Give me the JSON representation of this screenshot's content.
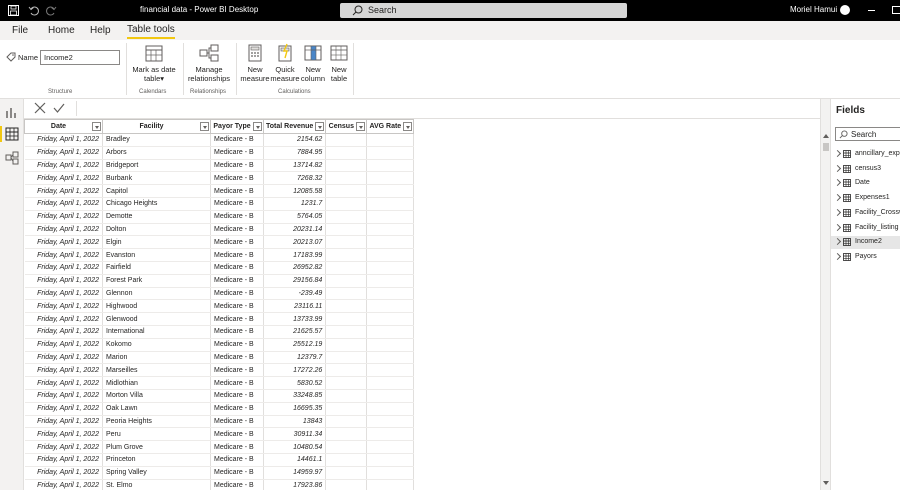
{
  "titlebar": {
    "title": "financial data - Power BI Desktop",
    "search_placeholder": "Search",
    "user": "Moriel Hamui"
  },
  "menu": {
    "tabs": [
      "File",
      "Home",
      "Help",
      "Table tools"
    ],
    "active": "Table tools"
  },
  "ribbon": {
    "name_label": "Name",
    "name_value": "Income2",
    "groups": {
      "structure": "Structure",
      "calendars": "Calendars",
      "relationships": "Relationships",
      "calculations": "Calculations"
    },
    "buttons": {
      "mark_date_line1": "Mark as date",
      "mark_date_line2": "table",
      "manage_rel_line1": "Manage",
      "manage_rel_line2": "relationships",
      "new_measure_line1": "New",
      "new_measure_line2": "measure",
      "quick_measure_line1": "Quick",
      "quick_measure_line2": "measure",
      "new_column_line1": "New",
      "new_column_line2": "column",
      "new_table_line1": "New",
      "new_table_line2": "table"
    }
  },
  "table": {
    "columns": [
      "Date",
      "Facility",
      "Payor Type",
      "Total Revenue",
      "Census",
      "AVG Rate"
    ],
    "rows": [
      [
        "Friday, April 1, 2022",
        "Bradley",
        "Medicare - B",
        "2154.62"
      ],
      [
        "Friday, April 1, 2022",
        "Arbors",
        "Medicare - B",
        "7884.95"
      ],
      [
        "Friday, April 1, 2022",
        "Bridgeport",
        "Medicare - B",
        "13714.82"
      ],
      [
        "Friday, April 1, 2022",
        "Burbank",
        "Medicare - B",
        "7268.32"
      ],
      [
        "Friday, April 1, 2022",
        "Capitol",
        "Medicare - B",
        "12085.58"
      ],
      [
        "Friday, April 1, 2022",
        "Chicago Heights",
        "Medicare - B",
        "1231.7"
      ],
      [
        "Friday, April 1, 2022",
        "Demotte",
        "Medicare - B",
        "5764.05"
      ],
      [
        "Friday, April 1, 2022",
        "Dolton",
        "Medicare - B",
        "20231.14"
      ],
      [
        "Friday, April 1, 2022",
        "Elgin",
        "Medicare - B",
        "20213.07"
      ],
      [
        "Friday, April 1, 2022",
        "Evanston",
        "Medicare - B",
        "17183.99"
      ],
      [
        "Friday, April 1, 2022",
        "Fairfield",
        "Medicare - B",
        "26952.82"
      ],
      [
        "Friday, April 1, 2022",
        "Forest Park",
        "Medicare - B",
        "29156.84"
      ],
      [
        "Friday, April 1, 2022",
        "Glennon",
        "Medicare - B",
        "-239.49"
      ],
      [
        "Friday, April 1, 2022",
        "Highwood",
        "Medicare - B",
        "23116.11"
      ],
      [
        "Friday, April 1, 2022",
        "Glenwood",
        "Medicare - B",
        "13733.99"
      ],
      [
        "Friday, April 1, 2022",
        "International",
        "Medicare - B",
        "21625.57"
      ],
      [
        "Friday, April 1, 2022",
        "Kokomo",
        "Medicare - B",
        "25512.19"
      ],
      [
        "Friday, April 1, 2022",
        "Marion",
        "Medicare - B",
        "12379.7"
      ],
      [
        "Friday, April 1, 2022",
        "Marseilles",
        "Medicare - B",
        "17272.26"
      ],
      [
        "Friday, April 1, 2022",
        "Midlothian",
        "Medicare - B",
        "5830.52"
      ],
      [
        "Friday, April 1, 2022",
        "Morton Villa",
        "Medicare - B",
        "33248.85"
      ],
      [
        "Friday, April 1, 2022",
        "Oak Lawn",
        "Medicare - B",
        "16695.35"
      ],
      [
        "Friday, April 1, 2022",
        "Peoria Heights",
        "Medicare - B",
        "13843"
      ],
      [
        "Friday, April 1, 2022",
        "Peru",
        "Medicare - B",
        "30911.34"
      ],
      [
        "Friday, April 1, 2022",
        "Plum Grove",
        "Medicare - B",
        "10480.54"
      ],
      [
        "Friday, April 1, 2022",
        "Princeton",
        "Medicare - B",
        "14461.1"
      ],
      [
        "Friday, April 1, 2022",
        "Spring Valley",
        "Medicare - B",
        "14959.97"
      ],
      [
        "Friday, April 1, 2022",
        "St. Elmo",
        "Medicare - B",
        "17923.86"
      ]
    ]
  },
  "fields": {
    "title": "Fields",
    "search_placeholder": "Search",
    "items": [
      "anncillary_exp",
      "census3",
      "Date",
      "Expenses1",
      "Facility_Crossw",
      "Facility_listing",
      "Income2",
      "Payors"
    ],
    "selected": "Income2"
  },
  "colors": {
    "accent": "#f2c811",
    "titlebar_bg": "#000000",
    "ribbon_bg": "#f3f2f1"
  },
  "icons": {
    "save": "save-icon",
    "undo": "undo-icon",
    "redo": "redo-icon",
    "search": "search-icon",
    "report_view": "report-view-icon",
    "data_view": "data-view-icon",
    "model_view": "model-view-icon"
  }
}
